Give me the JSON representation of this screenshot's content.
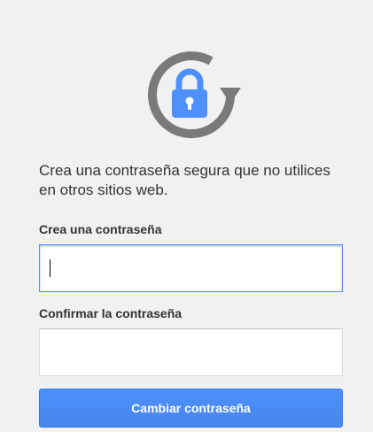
{
  "colors": {
    "background": "#f1f1f1",
    "accent": "#4d90fe",
    "icon_gray": "#7a7a7a",
    "text": "#333333"
  },
  "header": {
    "icon": "lock-refresh-icon"
  },
  "intro_text": "Crea una contraseña segura que no utilices en otros sitios web.",
  "form": {
    "new_password_label": "Crea una contraseña",
    "new_password_value": "",
    "confirm_password_label": "Confirmar la contraseña",
    "confirm_password_value": "",
    "submit_label": "Cambiar contraseña"
  }
}
